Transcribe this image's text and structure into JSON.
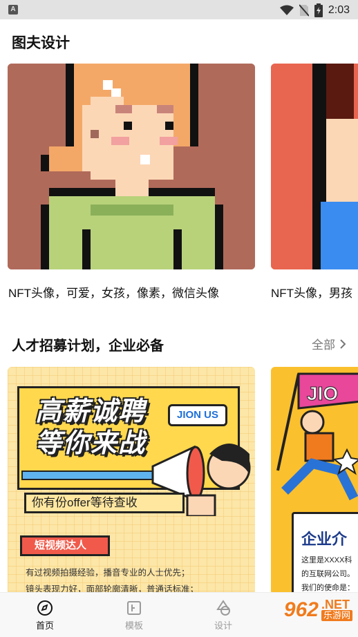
{
  "status_bar": {
    "notification_icon": "A",
    "time": "2:03",
    "icons": [
      "wifi-icon",
      "no-sim-icon",
      "battery-charging-icon"
    ]
  },
  "header": {
    "title": "图夫设计"
  },
  "avatars": {
    "cards": [
      {
        "caption": "NFT头像，可爱，女孩，像素，微信头像"
      },
      {
        "caption": "NFT头像，男孩"
      }
    ]
  },
  "recruit_section": {
    "title": "人才招募计划，企业必备",
    "more_label": "全部",
    "posters": [
      {
        "headline_line1": "高薪诚聘",
        "headline_line2": "等你来战",
        "bubble": "JION US",
        "offer": "你有份offer等待查收",
        "tag": "短视频达人",
        "body_line1": "有过视频拍摄经验，播音专业的人士优先；",
        "body_line2": "镜头表现力好，面部轮廓清晰，普通话标准；"
      },
      {
        "flag": "JIO",
        "title": "企业介",
        "text_line1": "这里是XXXX科",
        "text_line2": "的互联网公司。",
        "text_line3": "我们的使命是："
      }
    ]
  },
  "bottom_nav": {
    "items": [
      {
        "label": "首页",
        "icon": "compass-icon",
        "active": true
      },
      {
        "label": "模板",
        "icon": "template-icon",
        "active": false
      },
      {
        "label": "设计",
        "icon": "design-shapes-icon",
        "active": false
      }
    ]
  },
  "watermark": {
    "number": "962",
    "net": ".NET",
    "site": "乐游网"
  },
  "colors": {
    "accent": "#111111",
    "inactive": "#9a9a9a",
    "watermark": "#f07b1e"
  }
}
